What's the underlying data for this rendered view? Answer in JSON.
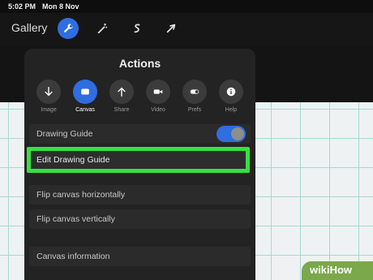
{
  "status_bar": {
    "time": "5:02 PM",
    "date": "Mon 8 Nov"
  },
  "toolbar": {
    "gallery_label": "Gallery",
    "tools": [
      {
        "icon": "wrench-icon",
        "active": true
      },
      {
        "icon": "magic-wand-icon",
        "active": false
      },
      {
        "icon": "selection-icon",
        "active": false
      },
      {
        "icon": "transform-arrow-icon",
        "active": false
      }
    ]
  },
  "actions_panel": {
    "title": "Actions",
    "tabs": [
      {
        "label": "Image",
        "icon": "down-arrow-icon",
        "active": false
      },
      {
        "label": "Canvas",
        "icon": "canvas-icon",
        "active": true
      },
      {
        "label": "Share",
        "icon": "up-arrow-icon",
        "active": false
      },
      {
        "label": "Video",
        "icon": "video-camera-icon",
        "active": false
      },
      {
        "label": "Prefs",
        "icon": "toggle-icon",
        "active": false
      },
      {
        "label": "Help",
        "icon": "info-icon",
        "active": false
      }
    ],
    "drawing_guide": {
      "label": "Drawing Guide",
      "enabled": true
    },
    "edit_drawing_guide": "Edit Drawing Guide",
    "flip_horizontal": "Flip canvas horizontally",
    "flip_vertical": "Flip canvas vertically",
    "canvas_information": "Canvas information"
  },
  "colors": {
    "accent": "#2f6de0",
    "highlight": "#33e33d",
    "grid": "#a8d9d0"
  },
  "watermark": "wikiHow"
}
